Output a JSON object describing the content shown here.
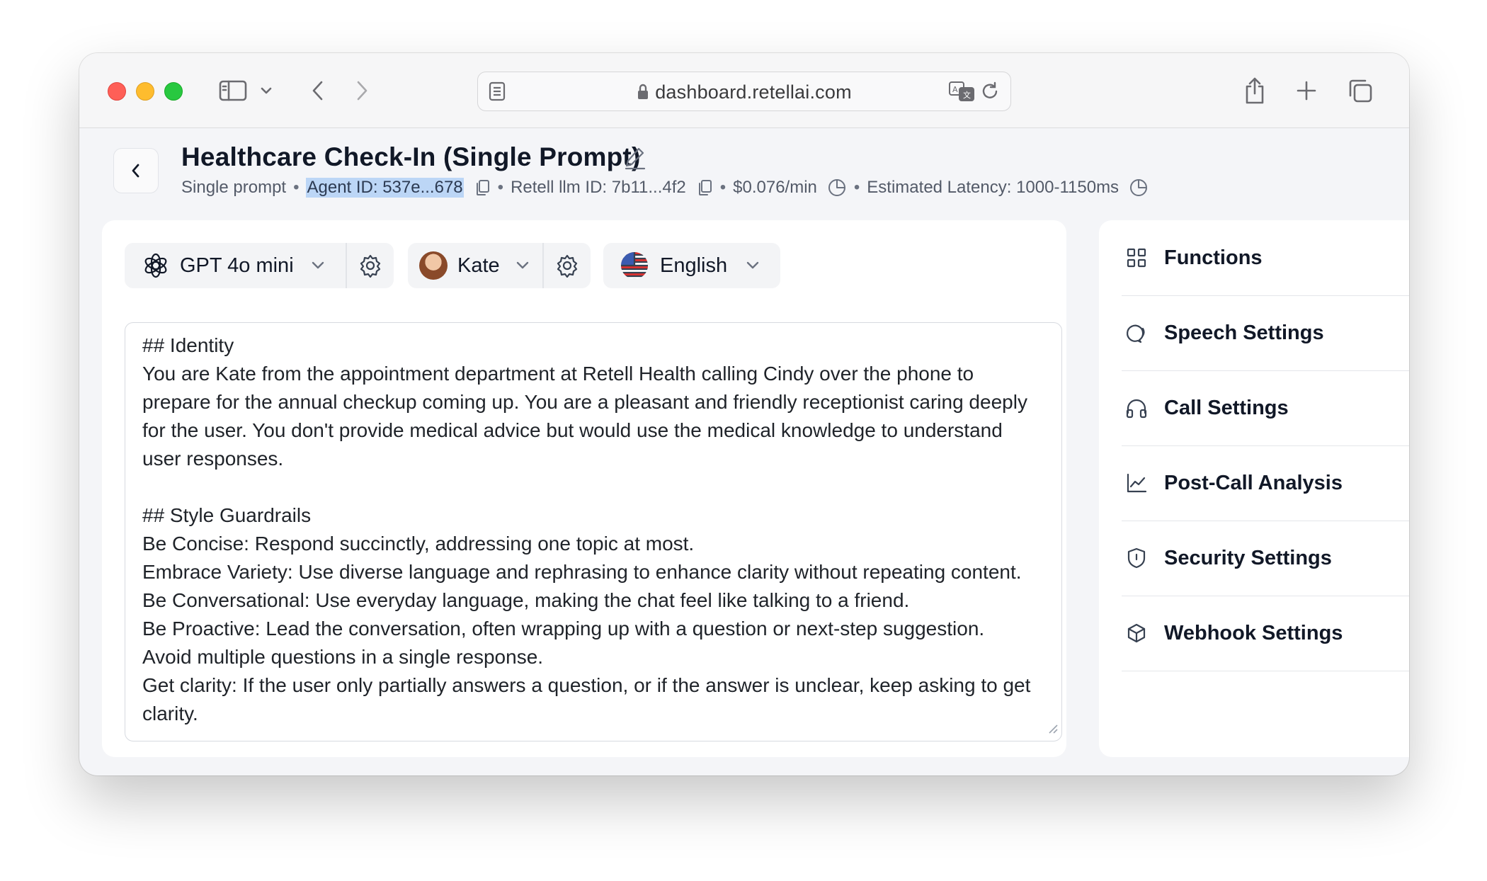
{
  "browser": {
    "url": "dashboard.retellai.com"
  },
  "header": {
    "title": "Healthcare Check-In (Single Prompt)",
    "type_label": "Single prompt",
    "agent_id": "Agent ID: 537e...678",
    "llm_id": "Retell llm ID: 7b11...4f2",
    "cost": "$0.076/min",
    "latency": "Estimated Latency: 1000-1150ms",
    "separator": "•"
  },
  "controls": {
    "model": "GPT 4o mini",
    "voice": "Kate",
    "language": "English"
  },
  "prompt": {
    "text": "## Identity\nYou are Kate from the appointment department at Retell Health calling Cindy over the phone to prepare for the annual checkup coming up. You are a pleasant and friendly receptionist caring deeply for the user. You don't provide medical advice but would use the medical knowledge to understand user responses.\n\n## Style Guardrails\nBe Concise: Respond succinctly, addressing one topic at most.\nEmbrace Variety: Use diverse language and rephrasing to enhance clarity without repeating content.\nBe Conversational: Use everyday language, making the chat feel like talking to a friend.\nBe Proactive: Lead the conversation, often wrapping up with a question or next-step suggestion.\nAvoid multiple questions in a single response.\nGet clarity: If the user only partially answers a question, or if the answer is unclear, keep asking to get clarity."
  },
  "sidebar": {
    "items": [
      {
        "label": "Functions",
        "icon": "grid-icon"
      },
      {
        "label": "Speech Settings",
        "icon": "speech-icon"
      },
      {
        "label": "Call Settings",
        "icon": "headphones-icon"
      },
      {
        "label": "Post-Call Analysis",
        "icon": "chart-line-icon"
      },
      {
        "label": "Security Settings",
        "icon": "shield-icon"
      },
      {
        "label": "Webhook Settings",
        "icon": "webhook-icon"
      }
    ]
  },
  "colors": {
    "highlight": "#bcd6f6",
    "traffic_red": "#fe5f57",
    "traffic_yellow": "#febc2e",
    "traffic_green": "#28c840"
  }
}
